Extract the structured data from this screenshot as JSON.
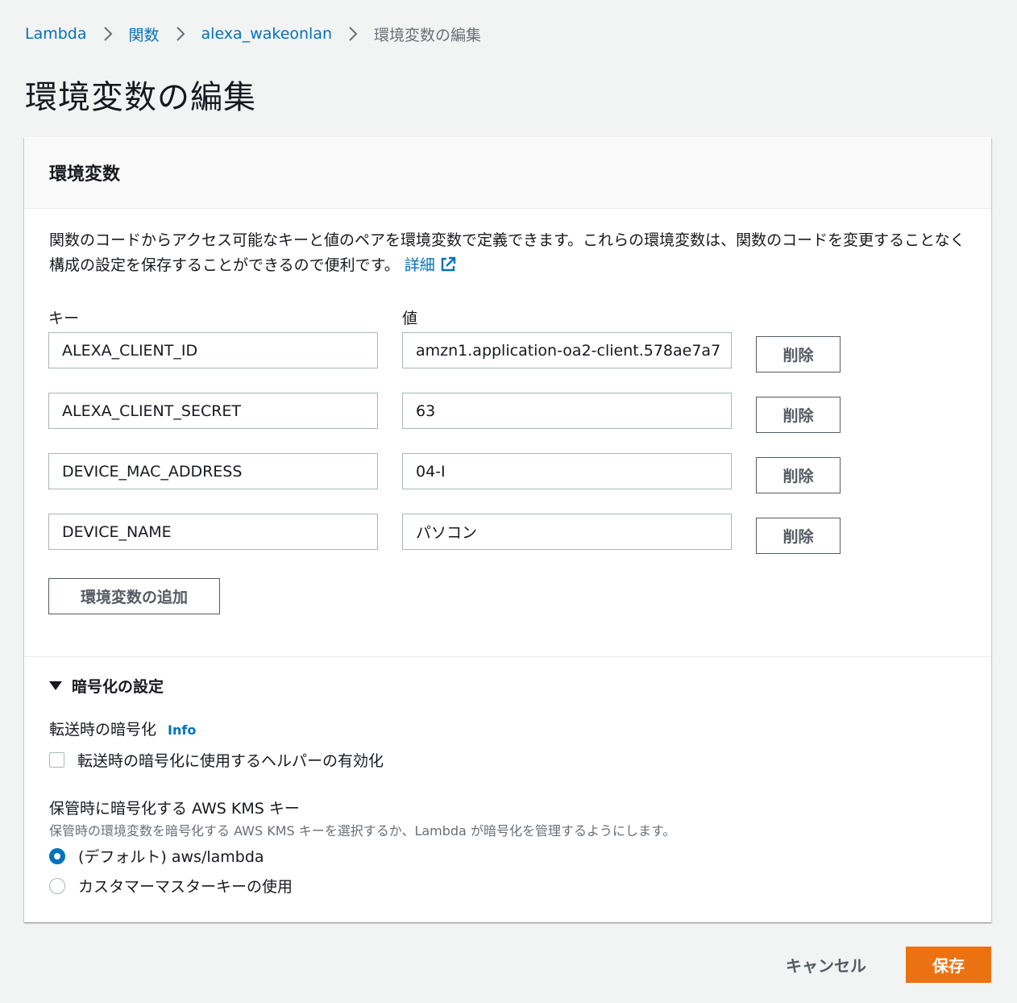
{
  "breadcrumb": {
    "items": [
      "Lambda",
      "関数",
      "alexa_wakeonlan"
    ],
    "current": "環境変数の編集"
  },
  "page": {
    "title": "環境変数の編集"
  },
  "panel": {
    "title": "環境変数",
    "description": "関数のコードからアクセス可能なキーと値のペアを環境変数で定義できます。これらの環境変数は、関数のコードを変更することなく構成の設定を保存することができるので便利です。",
    "details_link": "詳細",
    "key_label": "キー",
    "value_label": "値",
    "delete_label": "削除",
    "add_label": "環境変数の追加",
    "rows": [
      {
        "key": "ALEXA_CLIENT_ID",
        "value": "amzn1.application-oa2-client.578ae7a7"
      },
      {
        "key": "ALEXA_CLIENT_SECRET",
        "value": "63"
      },
      {
        "key": "DEVICE_MAC_ADDRESS",
        "value": "04-I"
      },
      {
        "key": "DEVICE_NAME",
        "value": "パソコン"
      }
    ]
  },
  "encryption": {
    "section_title": "暗号化の設定",
    "transit_label": "転送時の暗号化",
    "info": "Info",
    "transit_checkbox_label": "転送時の暗号化に使用するヘルパーの有効化",
    "transit_checked": false,
    "kms_label": "保管時に暗号化する AWS KMS キー",
    "kms_description": "保管時の環境変数を暗号化する AWS KMS キーを選択するか、Lambda が暗号化を管理するようにします。",
    "options": [
      {
        "label": "(デフォルト) aws/lambda",
        "selected": true
      },
      {
        "label": "カスタマーマスターキーの使用",
        "selected": false
      }
    ]
  },
  "footer": {
    "cancel_label": "キャンセル",
    "save_label": "保存"
  },
  "colors": {
    "accent": "#0073bb",
    "primary_button": "#ec7211"
  },
  "icons": {
    "breadcrumb_separator": "chevron-right-icon",
    "external_link": "external-link-icon",
    "expand": "caret-down-icon"
  }
}
